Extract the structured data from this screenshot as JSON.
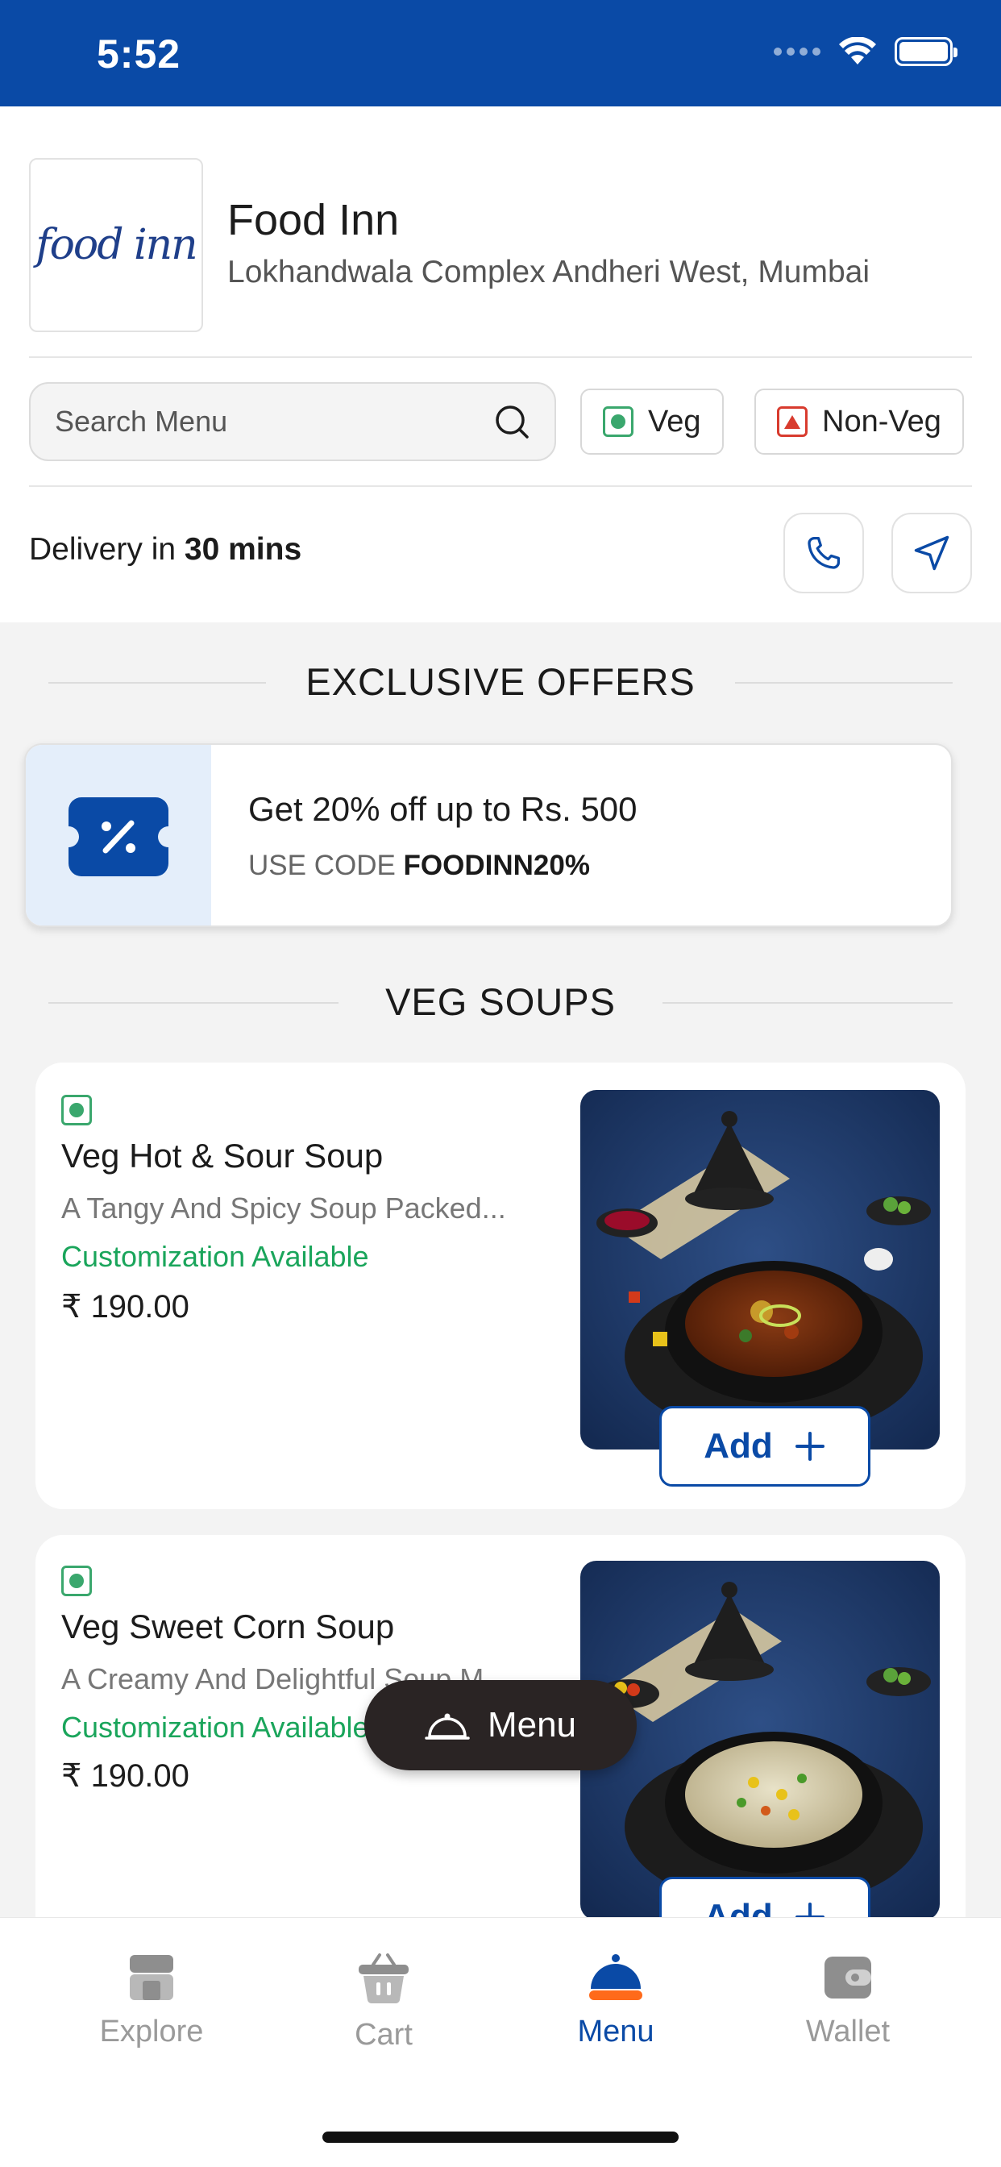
{
  "status_bar": {
    "time": "5:52"
  },
  "restaurant": {
    "logo_text": "food inn",
    "name": "Food Inn",
    "address": "Lokhandwala Complex Andheri West, Mumbai"
  },
  "search": {
    "placeholder": "Search Menu"
  },
  "filters": {
    "veg_label": "Veg",
    "nonveg_label": "Non-Veg"
  },
  "delivery": {
    "prefix": "Delivery in",
    "time": "30 mins"
  },
  "offers": {
    "section_title": "EXCLUSIVE OFFERS",
    "card": {
      "title": "Get 20% off up to Rs. 500",
      "code_prefix": "USE CODE",
      "code": "FOODINN20%"
    }
  },
  "menu_section": {
    "title": "VEG SOUPS",
    "items": [
      {
        "name": "Veg Hot & Sour Soup",
        "description": "A Tangy And Spicy Soup Packed...",
        "customization": "Customization Available",
        "price": "₹ 190.00",
        "add_label": "Add"
      },
      {
        "name": "Veg Sweet Corn Soup",
        "description": "A Creamy And Delightful Soup M...",
        "customization": "Customization Available",
        "price": "₹ 190.00",
        "add_label": "Add"
      }
    ]
  },
  "floating_menu": {
    "label": "Menu"
  },
  "tab_bar": {
    "tabs": [
      {
        "label": "Explore",
        "icon": "store-icon"
      },
      {
        "label": "Cart",
        "icon": "basket-icon"
      },
      {
        "label": "Menu",
        "icon": "cloche-icon",
        "active": true
      },
      {
        "label": "Wallet",
        "icon": "wallet-icon"
      }
    ]
  },
  "colors": {
    "brand_blue": "#0a4aa6",
    "veg_green": "#3aa76d",
    "nonveg_red": "#d83b2e",
    "custom_green": "#1aa55b",
    "active_orange": "#ff6a1a"
  }
}
